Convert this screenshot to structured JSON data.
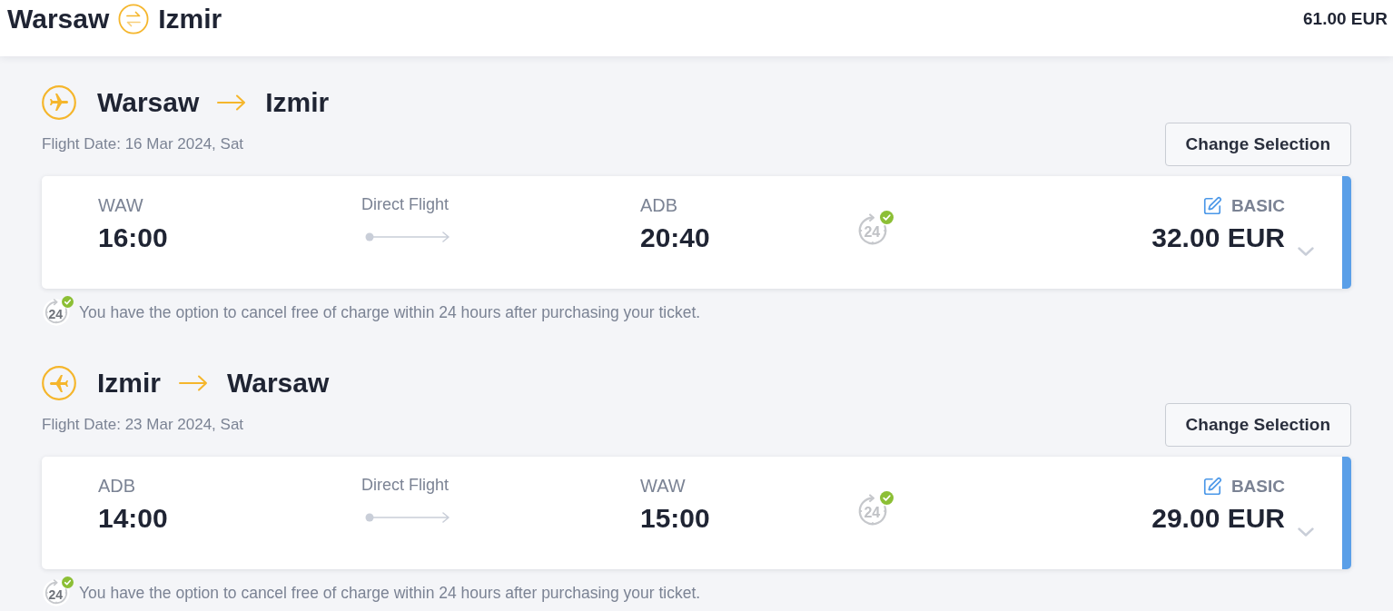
{
  "header": {
    "origin": "Warsaw",
    "destination": "Izmir",
    "total": "61.00 EUR"
  },
  "legs": [
    {
      "kind": "outbound",
      "origin": "Warsaw",
      "destination": "Izmir",
      "date": "Flight Date: 16 Mar 2024, Sat",
      "change_button": "Change Selection",
      "flight": {
        "selected": true,
        "expanded": false,
        "departure_code": "WAW",
        "departure_time": "16:00",
        "connection": "Direct Flight",
        "arrival_code": "ADB",
        "arrival_time": "20:40",
        "cancel_badge": "24",
        "fare": "BASIC",
        "price": "32.00 EUR"
      },
      "note": {
        "badge": "24",
        "text": "You have the option to cancel free of charge within 24 hours after purchasing your ticket."
      }
    },
    {
      "kind": "return",
      "origin": "Izmir",
      "destination": "Warsaw",
      "date": "Flight Date: 23 Mar 2024, Sat",
      "change_button": "Change Selection",
      "flight": {
        "selected": true,
        "expanded": false,
        "departure_code": "ADB",
        "departure_time": "14:00",
        "connection": "Direct Flight",
        "arrival_code": "WAW",
        "arrival_time": "15:00",
        "cancel_badge": "24",
        "fare": "BASIC",
        "price": "29.00 EUR"
      },
      "note": {
        "badge": "24",
        "text": "You have the option to cancel free of charge within 24 hours after purchasing your ticket."
      }
    }
  ]
}
